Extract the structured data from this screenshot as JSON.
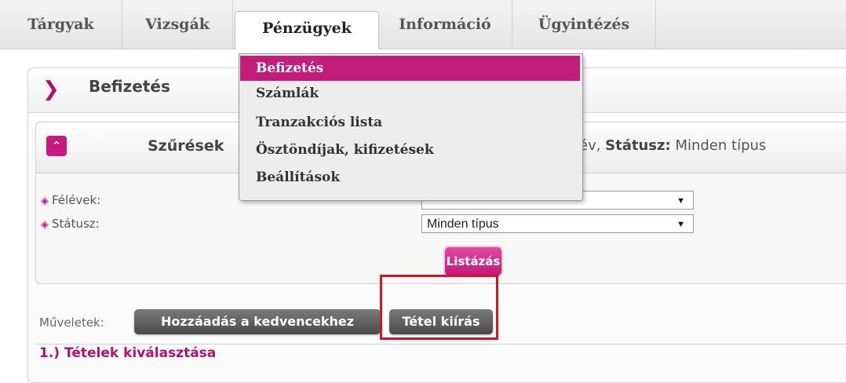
{
  "tabs": [
    {
      "label": "Tárgyak"
    },
    {
      "label": "Vizsgák"
    },
    {
      "label": "Pénzügyek",
      "active": true
    },
    {
      "label": "Információ"
    },
    {
      "label": "Ügyintézés"
    }
  ],
  "menu": {
    "items": [
      {
        "label": "Befizetés",
        "highlighted": true
      },
      {
        "label": "Számlák"
      },
      {
        "label": "Tranzakciós lista"
      },
      {
        "label": "Ösztöndíjak, kifizetések"
      },
      {
        "label": "Beállítások"
      }
    ]
  },
  "page": {
    "title": "Befizetés"
  },
  "filter": {
    "title": "Szűrések",
    "summary_prefix": "év, ",
    "summary_status_label": "Státusz:",
    "summary_status_value": "Minden típus",
    "fields": [
      {
        "label": "Félévek:",
        "value": ""
      },
      {
        "label": "Státusz:",
        "value": "Minden típus"
      }
    ],
    "list_button": "Listázás"
  },
  "actions": {
    "label": "Műveletek:",
    "add_favorites": "Hozzáadás a kedvencekhez",
    "post_item": "Tétel kiírás"
  },
  "section": {
    "title": "1.) Tételek kiválasztása"
  },
  "colors": {
    "accent": "#c31d7c",
    "highlight_frame": "#d0152a"
  }
}
